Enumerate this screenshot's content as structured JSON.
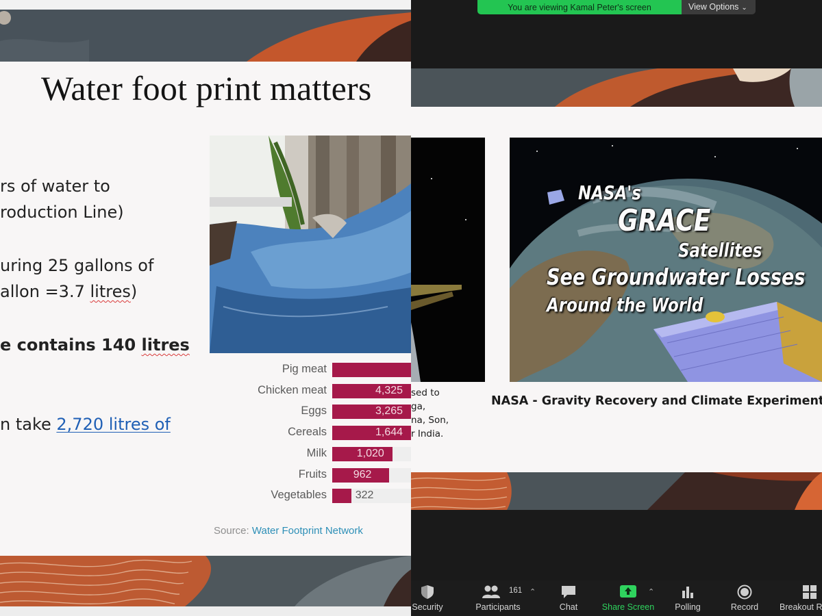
{
  "left_slide": {
    "title": "Water foot print matters",
    "bullets": {
      "b1_l1": "rs of water to",
      "b1_l2": "roduction Line)",
      "b2_l1": "uring 25 gallons of",
      "b2_l2_pre": "allon =3.7 ",
      "b2_l2_word": "litres",
      "b2_l2_post": ")",
      "b3_pre": "e contains 140 ",
      "b3_word": "litres",
      "b4_pre": "n take ",
      "b4_link": "2,720 litres of"
    },
    "chart_source_label": "Source:",
    "chart_source_link": "Water Footprint Network"
  },
  "chart_data": {
    "type": "bar",
    "orientation": "horizontal",
    "categories": [
      "Pig meat",
      "Chicken meat",
      "Eggs",
      "Cereals",
      "Milk",
      "Fruits",
      "Vegetables"
    ],
    "values": [
      null,
      4325,
      3265,
      1644,
      1020,
      962,
      322
    ],
    "value_labels": [
      "",
      "4,325",
      "3,265",
      "1,644",
      "1,020",
      "962",
      "322"
    ],
    "bar_color": "#a6194a",
    "source": "Source: Water Footprint Network"
  },
  "zoom": {
    "viewing_banner": "You are viewing Kamal Peter's screen",
    "view_options": "View Options",
    "colors": {
      "banner_green": "#23c552",
      "share_green": "#2fd35e"
    },
    "clipped_text": [
      "sed to",
      "ga,",
      "na, Son,",
      "r India."
    ],
    "grace_caption": "NASA - Gravity Recovery and Climate Experiment (GRA",
    "grace_video": {
      "line1": "NASA's",
      "line2": "GRACE",
      "line3": "Satellites",
      "line4": "See Groundwater Losses",
      "line5": "Around the World"
    },
    "toolbar": {
      "security": "Security",
      "participants": "Participants",
      "participants_count": "161",
      "chat": "Chat",
      "share_screen": "Share Screen",
      "polling": "Polling",
      "record": "Record",
      "breakout": "Breakout R",
      "icons": [
        "shield-icon",
        "participants-icon",
        "chat-icon",
        "share-screen-icon",
        "polling-icon",
        "record-icon",
        "breakout-rooms-icon"
      ]
    }
  }
}
